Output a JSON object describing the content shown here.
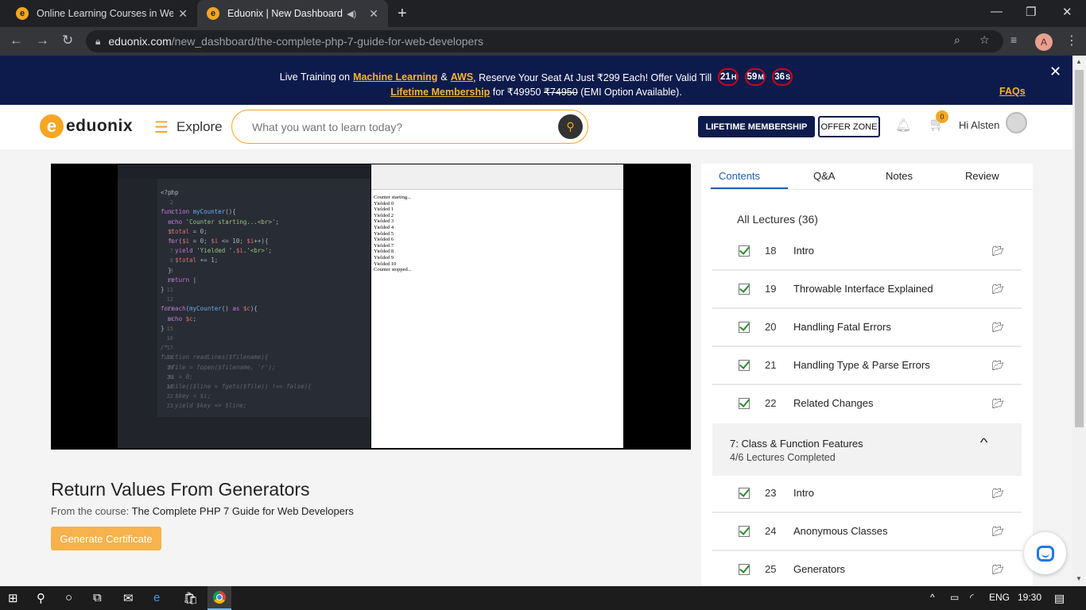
{
  "browser": {
    "tabs": [
      {
        "title": "Online Learning Courses in Web,"
      },
      {
        "title": "Eduonix | New Dashboard"
      }
    ],
    "url_host": "eduonix.com",
    "url_path": "/new_dashboard/the-complete-php-7-guide-for-web-developers",
    "profile_initial": "A"
  },
  "banner": {
    "lead": "Live Training on",
    "link1": "Machine Learning",
    "amp": "&",
    "link2": "AWS",
    "middle": ", Reserve Your Seat At Just ₹299 Each! Offer Valid Till",
    "timer_h": "21",
    "timer_m": "59",
    "timer_s": "36",
    "unit_h": "H",
    "unit_m": "M",
    "unit_s": "S",
    "membership_link": "Lifetime Membership",
    "price_pre": "for ₹49950",
    "price_old": "₹74950",
    "price_post": "(EMI Option Available).",
    "faqs": "FAQs"
  },
  "header": {
    "logo_letter": "e",
    "logo_text": "eduonix",
    "explore": "Explore",
    "search_placeholder": "What you want to learn today?",
    "lifetime_btn": "LIFETIME MEMBERSHIP",
    "offer_btn": "OFFER ZONE",
    "cart_count": "0",
    "greeting": "Hi Alsten"
  },
  "video": {
    "code_lines": [
      "<?php",
      "",
      "function myCounter(){",
      "  echo 'Counter starting...<br>';",
      "  $total = 0;",
      "  for($i = 0; $i <= 10; $i++){",
      "    yield 'Yielded '.$i.'<br>';",
      "    $total += 1;",
      "  }",
      "  return |",
      "}",
      "",
      "foreach(myCounter() as $c){",
      "  echo $c;",
      "}",
      "",
      "/*",
      "function readLines($filename){",
      "  $file = fopen($filename, 'r');",
      "  $i = 0;",
      "  while(($line = fgets($file)) !== false){",
      "    $key = $i;",
      "    yield $key => $line;"
    ],
    "output": "Counter starting...\nYielded 0\nYielded 1\nYielded 2\nYielded 3\nYielded 4\nYielded 5\nYielded 6\nYielded 7\nYielded 8\nYielded 9\nYielded 10\nCounter stopped..."
  },
  "lesson": {
    "title": "Return Values From Generators",
    "from_label": "From the course:",
    "course_name": "The Complete PHP 7 Guide for Web Developers",
    "cert_button": "Generate Certificate"
  },
  "panel": {
    "tabs": [
      "Contents",
      "Q&A",
      "Notes",
      "Review"
    ],
    "all_lectures": "All Lectures (36)",
    "lectures_a": [
      {
        "num": "18",
        "name": "Intro"
      },
      {
        "num": "19",
        "name": "Throwable Interface Explained"
      },
      {
        "num": "20",
        "name": "Handling Fatal Errors"
      },
      {
        "num": "21",
        "name": "Handling Type & Parse Errors"
      },
      {
        "num": "22",
        "name": "Related Changes"
      }
    ],
    "section": {
      "title": "7: Class & Function Features",
      "subtitle": "4/6 Lectures Completed"
    },
    "lectures_b": [
      {
        "num": "23",
        "name": "Intro"
      },
      {
        "num": "24",
        "name": "Anonymous Classes"
      },
      {
        "num": "25",
        "name": "Generators"
      }
    ]
  },
  "taskbar": {
    "lang": "ENG",
    "time": "19:30"
  }
}
